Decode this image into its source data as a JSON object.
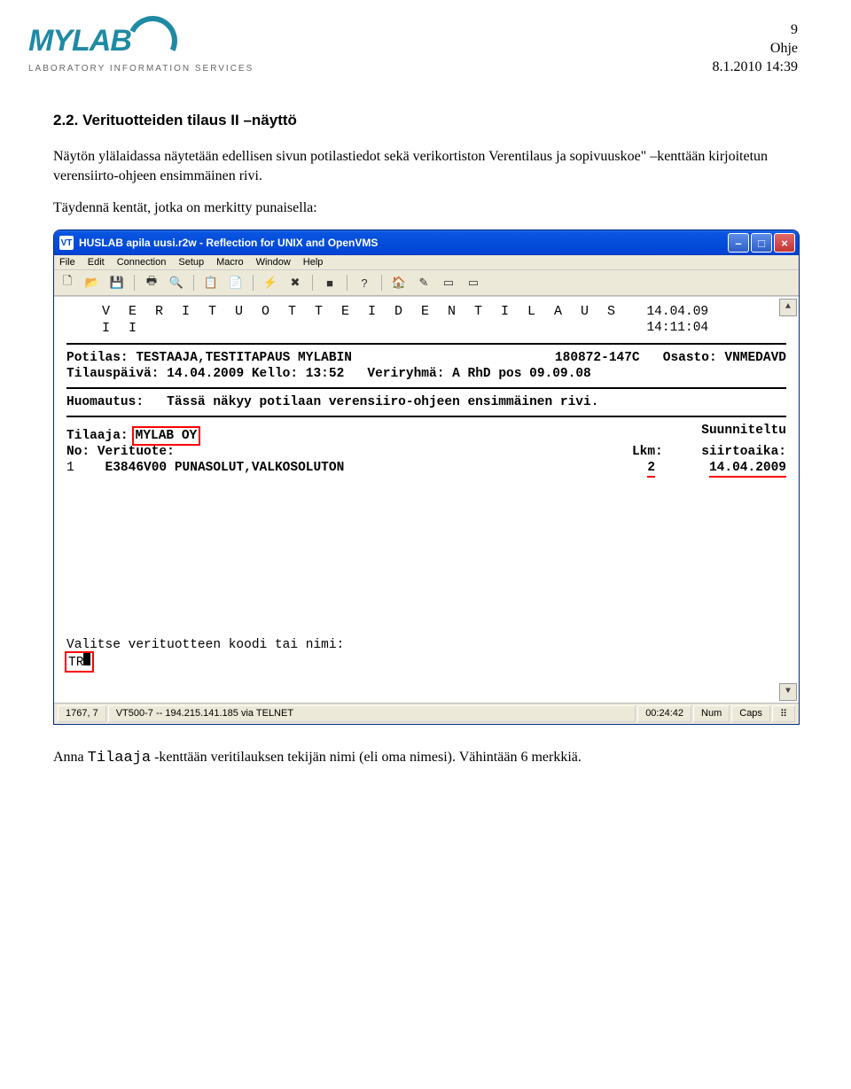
{
  "logo": {
    "name": "MYLAB",
    "subtitle": "LABORATORY INFORMATION SERVICES"
  },
  "page_meta": {
    "page_number": "9",
    "doc_type": "Ohje",
    "datetime": "8.1.2010 14:39"
  },
  "section": {
    "number": "2.2.",
    "title": "Verituotteiden tilaus II –näyttö"
  },
  "paragraphs": {
    "p1": "Näytön ylälaidassa näytetään edellisen sivun potilastiedot sekä verikortiston Verentilaus ja sopivuuskoe\" –kenttään kirjoitetun verensiirto-ohjeen ensimmäinen rivi.",
    "p2": "Täydennä kentät, jotka on merkitty punaisella:"
  },
  "window": {
    "title": "HUSLAB apila uusi.r2w - Reflection for UNIX and OpenVMS",
    "title_icon": "VT",
    "buttons": {
      "min": "–",
      "max": "□",
      "close": "×"
    },
    "menubar": [
      "File",
      "Edit",
      "Connection",
      "Setup",
      "Macro",
      "Window",
      "Help"
    ],
    "toolbar_icons": [
      "new",
      "open",
      "save",
      "sep",
      "print",
      "find",
      "sep",
      "copy",
      "paste",
      "sep",
      "connect",
      "disconnect",
      "sep",
      "stop",
      "sep",
      "help",
      "sep",
      "home",
      "pencil",
      "form1",
      "form2"
    ],
    "statusbar": {
      "pos": "1767, 7",
      "conn": "VT500-7 -- 194.215.141.185 via TELNET",
      "time": "00:24:42",
      "num": "Num",
      "caps": "Caps"
    }
  },
  "terminal": {
    "header": {
      "title": "V E R I T U O T T E I D E N   T I L A U S   I I",
      "date": "14.04.09",
      "time": "14:11:04"
    },
    "patient": {
      "label": "Potilas:",
      "name": "TESTAAJA,TESTITAPAUS MYLABIN",
      "ssn": "180872-147C",
      "ward_label": "Osasto:",
      "ward": "VNMEDAVD"
    },
    "order": {
      "date_label": "Tilauspäivä:",
      "date": "14.04.2009",
      "time_label": "Kello:",
      "time": "13:52",
      "bloodgroup_label": "Veriryhmä:",
      "bloodgroup": "A RhD pos 09.09.08"
    },
    "remark": {
      "label": "Huomautus:",
      "text": "Tässä näkyy potilaan verensiiro-ohjeen ensimmäinen rivi."
    },
    "tilaaja": {
      "label": "Tilaaja:",
      "value": "MYLAB OY"
    },
    "planned": {
      "line1": "Suunniteltu",
      "line2": "siirtoaika:"
    },
    "columns": {
      "no": "No:",
      "product": "Verituote:",
      "qty": "Lkm:"
    },
    "rows": {
      "no": "1",
      "code": "E3846V00",
      "name": "PUNASOLUT,VALKOSOLUTON",
      "qty": "2",
      "planned": "14.04.2009"
    },
    "prompt": {
      "line1": "Valitse verituotteen koodi tai nimi:",
      "input": "TR"
    }
  },
  "footer": {
    "prefix": "Anna ",
    "code": "Tilaaja",
    "suffix": " -kenttään veritilauksen tekijän nimi (eli oma nimesi). Vähintään 6 merkkiä."
  }
}
